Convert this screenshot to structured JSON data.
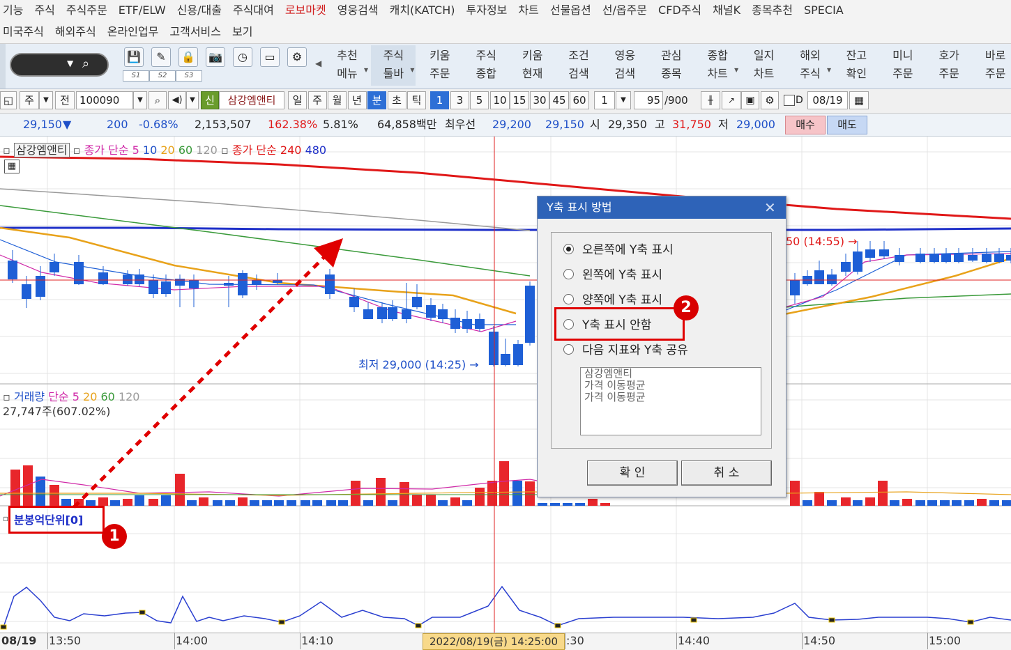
{
  "menu": {
    "row1": [
      "기능",
      "주식",
      "주식주문",
      "ETF/ELW",
      "신용/대출",
      "주식대여",
      "로보마켓",
      "영웅검색",
      "캐치(KATCH)",
      "투자정보",
      "차트",
      "선물옵션",
      "선/옵주문",
      "CFD주식",
      "채널K",
      "종목추천",
      "SPECIA"
    ],
    "row2": [
      "미국주식",
      "해외주식",
      "온라인업무",
      "고객서비스",
      "보기"
    ],
    "active_index": 6
  },
  "toolbar": {
    "slot_labels": [
      "S1",
      "S2",
      "S3"
    ],
    "buttons": [
      "추천\n메뉴",
      "주식\n툴바",
      "키움\n주문",
      "주식\n종합",
      "키움\n현재",
      "조건\n검색",
      "영웅\n검색",
      "관심\n종목",
      "종합\n차트",
      "일지\n차트",
      "해외\n주식",
      "잔고\n확인",
      "미니\n주문",
      "호가\n주문",
      "바로\n주문"
    ],
    "selected_index": 1
  },
  "controls": {
    "jong_label": "주",
    "jeon_label": "전",
    "code": "100090",
    "credit_badge": "신",
    "stock_name": "삼강엠앤티",
    "periods": [
      "일",
      "주",
      "월",
      "년",
      "분",
      "초",
      "틱"
    ],
    "active_period": "분",
    "intervals": [
      "1",
      "3",
      "5",
      "10",
      "15",
      "30",
      "45",
      "60"
    ],
    "active_interval": "1",
    "unit_value": "1",
    "count": "95",
    "count_total": "/900",
    "check_label": "D",
    "date": "08/19"
  },
  "info": {
    "price": "29,150",
    "direction": "▼",
    "change": "200",
    "change_pct": "-0.68%",
    "volume": "2,153,507",
    "volume_ratio": "162.38%",
    "turnover": "5.81%",
    "trade_value": "64,858백만",
    "best_ask_label": "최우선",
    "ask": "29,200",
    "bid": "29,150",
    "open_label": "시",
    "open": "29,350",
    "high_label": "고",
    "high": "31,750",
    "low_label": "저",
    "low": "29,000",
    "buy_label": "매수",
    "sell_label": "매도"
  },
  "price_panel": {
    "name_tag": "삼강엠앤티",
    "ma_label": "종가 단순",
    "ma_short": [
      "5",
      "10",
      "20",
      "60",
      "120"
    ],
    "ma_long_label": "종가 단순",
    "ma_long": [
      "240",
      "480"
    ],
    "low_annotation": "최저 29,000 (14:25)",
    "high_annotation_partial": "50 (14:55)"
  },
  "volume_panel": {
    "label": "거래량",
    "ma_label": "단순",
    "ma": [
      "5",
      "20",
      "60",
      "120"
    ],
    "current": "27,747주(607.02%)"
  },
  "indicator_panel": {
    "label": "분봉억단위[0]"
  },
  "time_axis": {
    "date": "08/19",
    "ticks": [
      "13:50",
      "14:00",
      "14:10",
      ":30",
      "14:40",
      "14:50",
      "15:00"
    ],
    "crosshair_label": "2022/08/19(금) 14:25:00"
  },
  "dialog": {
    "title": "Y축 표시 방법",
    "options": [
      "오른쪽에 Y축 표시",
      "왼쪽에 Y축 표시",
      "양쪽에 Y축 표시",
      "Y축 표시 안함",
      "다음 지표와 Y축 공유"
    ],
    "selected_index": 0,
    "list_items": [
      "삼강엠앤티",
      "가격 이동평균",
      "가격 이동평균"
    ],
    "ok_label": "확  인",
    "cancel_label": "취  소"
  },
  "annotations": {
    "badge1": "1",
    "badge2": "2"
  },
  "colors": {
    "up": "#e8262b",
    "down": "#1e5fd6",
    "ma240": "#e01818",
    "ma480": "#1e2fc8",
    "ma20": "#e8a21a",
    "ma60": "#3a9a3a",
    "ma120": "#9a9a9a",
    "ma5": "#d02aa8",
    "crosshair": "#e02020",
    "annotation": "#e00000"
  }
}
